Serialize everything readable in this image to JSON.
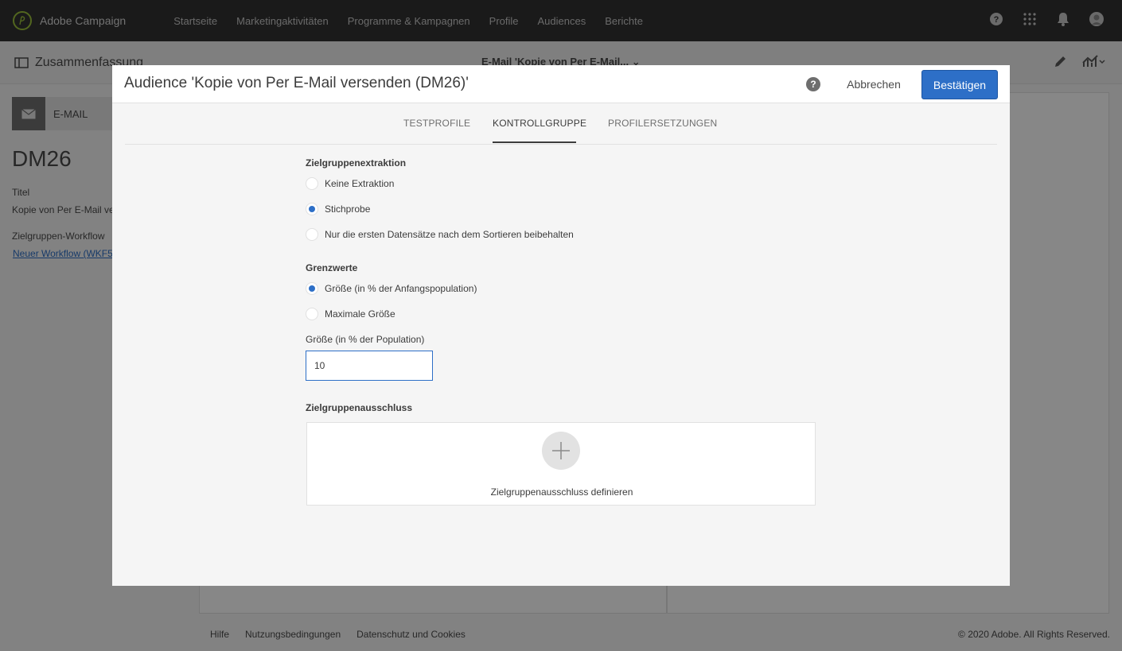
{
  "topbar": {
    "brand": "Adobe Campaign",
    "nav": [
      "Startseite",
      "Marketingaktivitäten",
      "Programme & Kampagnen",
      "Profile",
      "Audiences",
      "Berichte"
    ]
  },
  "background": {
    "summary_title": "Zusammenfassung",
    "center_title": "E-Mail 'Kopie von Per E-Mail...",
    "email_chip": "E-MAIL",
    "dm_title": "DM26",
    "title_label": "Titel",
    "title_value": "Kopie von Per E-Mail ve",
    "workflow_label": "Zielgruppen-Workflow",
    "workflow_link": "Neuer Workflow (WKF5"
  },
  "footer": {
    "links": [
      "Hilfe",
      "Nutzungsbedingungen",
      "Datenschutz und Cookies"
    ],
    "copyright": "© 2020 Adobe. All Rights Reserved."
  },
  "dialog": {
    "title": "Audience 'Kopie von Per E-Mail versenden (DM26)'",
    "help": "?",
    "cancel_label": "Abbrechen",
    "confirm_label": "Bestätigen",
    "tabs": [
      "TESTPROFILE",
      "KONTROLLGRUPPE",
      "PROFILERSETZUNGEN"
    ],
    "active_tab": "KONTROLLGRUPPE",
    "extraction": {
      "title": "Zielgruppenextraktion",
      "options": [
        "Keine Extraktion",
        "Stichprobe",
        "Nur die ersten Datensätze nach dem Sortieren beibehalten"
      ],
      "selected": "Stichprobe"
    },
    "limits": {
      "title": "Grenzwerte",
      "options": [
        "Größe (in % der Anfangspopulation)",
        "Maximale Größe"
      ],
      "selected": "Größe (in % der Anfangspopulation)"
    },
    "size_field": {
      "label": "Größe (in % der Population)",
      "value": "10"
    },
    "exclusion": {
      "title": "Zielgruppenausschluss",
      "action": "Zielgruppenausschluss definieren"
    }
  },
  "colors": {
    "accent": "#2d6fc7",
    "topbar": "#323232",
    "brand_logo": "#9bc13c"
  }
}
